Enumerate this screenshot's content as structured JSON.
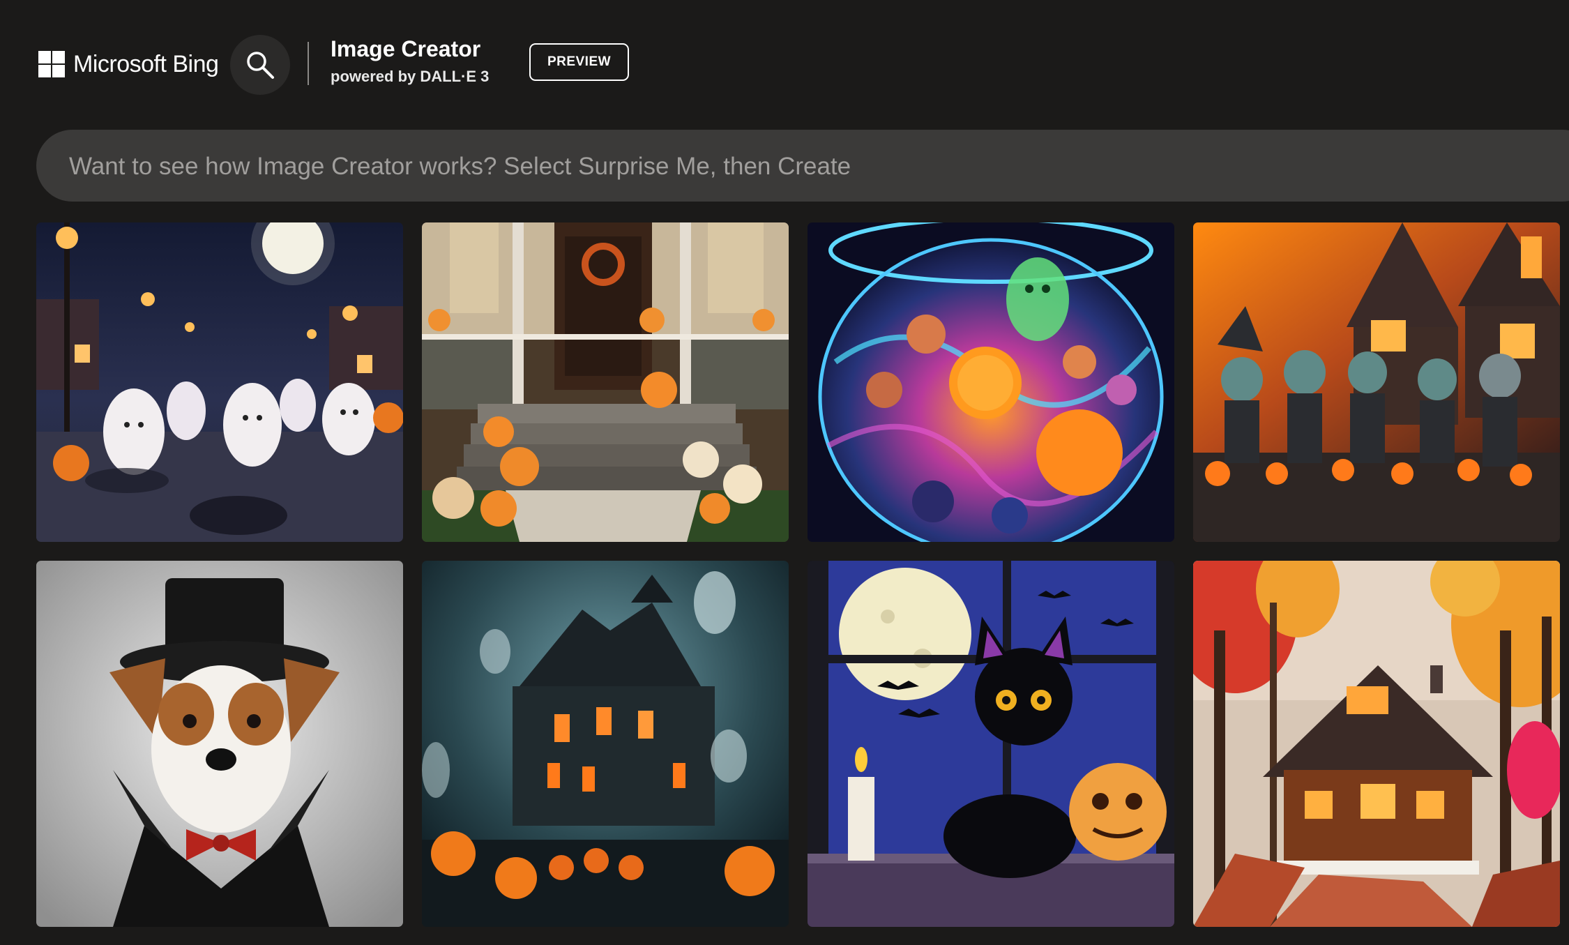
{
  "header": {
    "brand_name": "Microsoft Bing",
    "brand_icon": "windows-logo-icon",
    "search_icon": "search-icon",
    "product_title": "Image Creator",
    "product_subtitle": "powered by DALL·E 3",
    "preview_label": "PREVIEW"
  },
  "prompt": {
    "placeholder": "Want to see how Image Creator works? Select Surprise Me, then Create",
    "value": ""
  },
  "gallery": {
    "images": [
      {
        "name": "ghosts-street-image"
      },
      {
        "name": "porch-pumpkins-image"
      },
      {
        "name": "glowing-bowl-image"
      },
      {
        "name": "orange-fog-kids-image"
      },
      {
        "name": "dog-vampire-image"
      },
      {
        "name": "haunted-house-image"
      },
      {
        "name": "black-cat-window-image"
      },
      {
        "name": "autumn-cabin-image"
      }
    ]
  },
  "colors": {
    "background": "#1b1a19",
    "prompt_bar": "#3b3a39",
    "search_button": "#2b2a29",
    "text": "#ffffff",
    "placeholder": "#a19f9d"
  }
}
